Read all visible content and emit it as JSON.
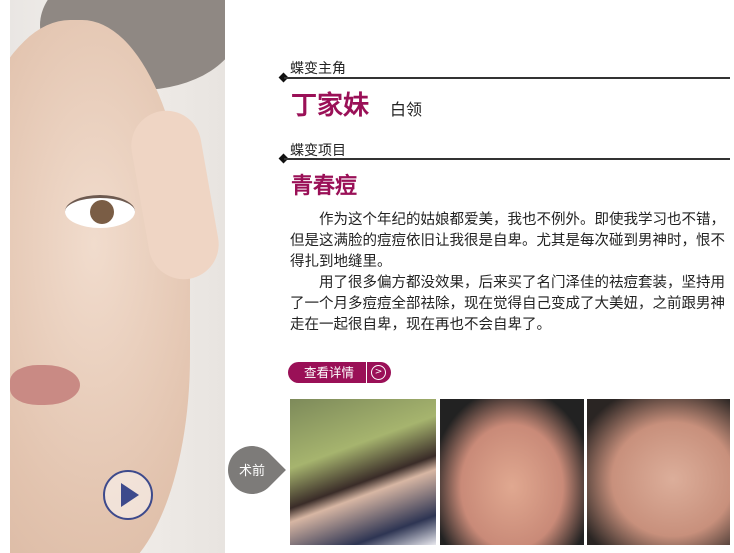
{
  "section1_label": "蝶变主角",
  "name": "丁家妹",
  "role": "白领",
  "section2_label": "蝶变项目",
  "project": "青春痘",
  "paragraphs": [
    "作为这个年纪的姑娘都爱美，我也不例外。即使我学习也不错，但是这满脸的痘痘依旧让我很是自卑。尤其是每次碰到男神时，恨不得扎到地缝里。",
    "用了很多偏方都没效果，后来买了名门泽佳的祛痘套装，坚持用了一个月多痘痘全部祛除，现在觉得自己变成了大美妞，之前跟男神走在一起很自卑，现在再也不会自卑了。"
  ],
  "details_button": "查看详情",
  "before_tag": "术前",
  "colors": {
    "accent": "#9a1057",
    "tag": "#7d7b79",
    "play": "#3d4a8c"
  }
}
